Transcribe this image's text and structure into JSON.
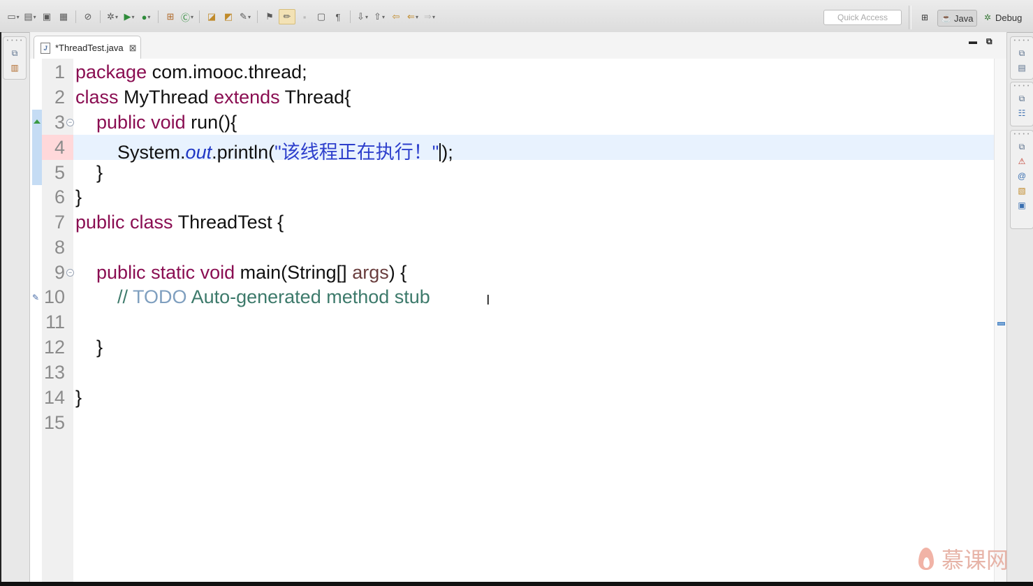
{
  "toolbar": {
    "quick_access_placeholder": "Quick Access",
    "perspectives": [
      {
        "label": "Java",
        "active": true,
        "icon": "java-perspective-icon"
      },
      {
        "label": "Debug",
        "active": false,
        "icon": "debug-perspective-icon"
      }
    ]
  },
  "editor": {
    "tab_title": "*ThreadTest.java",
    "tab_icon": "java-file-icon",
    "current_line": 4,
    "lines": [
      {
        "n": "1"
      },
      {
        "n": "2"
      },
      {
        "n": "3"
      },
      {
        "n": "4"
      },
      {
        "n": "5"
      },
      {
        "n": "6"
      },
      {
        "n": "7"
      },
      {
        "n": "8"
      },
      {
        "n": "9"
      },
      {
        "n": "10"
      },
      {
        "n": "11"
      },
      {
        "n": "12"
      },
      {
        "n": "13"
      },
      {
        "n": "14"
      },
      {
        "n": "15"
      }
    ],
    "code": {
      "l1_kw": "package",
      "l1_rest": " com.imooc.thread;",
      "l2_kw1": "class",
      "l2_name": " MyThread ",
      "l2_kw2": "extends",
      "l2_rest": " Thread{",
      "l3_indent": "    ",
      "l3_kw": "public void",
      "l3_rest": " run(){",
      "l4_indent": "        ",
      "l4_sys": "System.",
      "l4_field": "out",
      "l4_call": ".println(",
      "l4_str": "\"该线程正在执行！\"",
      "l4_end": ");",
      "l5_text": "    }",
      "l6_text": "}",
      "l7_kw": "public class",
      "l7_rest": " ThreadTest {",
      "l9_indent": "    ",
      "l9_kw": "public static void",
      "l9_rest1": " main(String[] ",
      "l9_param": "args",
      "l9_rest2": ") {",
      "l10_indent": "        ",
      "l10_slash": "// ",
      "l10_todo": "TODO",
      "l10_rest": " Auto-generated method stub",
      "l12_text": "    }",
      "l14_text": "}"
    }
  },
  "colors": {
    "keyword": "#8a0e52",
    "string": "#2d3fcc",
    "comment": "#3d7a6b",
    "current_line_bg": "#e8f2fe"
  },
  "watermark": {
    "text": "慕课网"
  }
}
